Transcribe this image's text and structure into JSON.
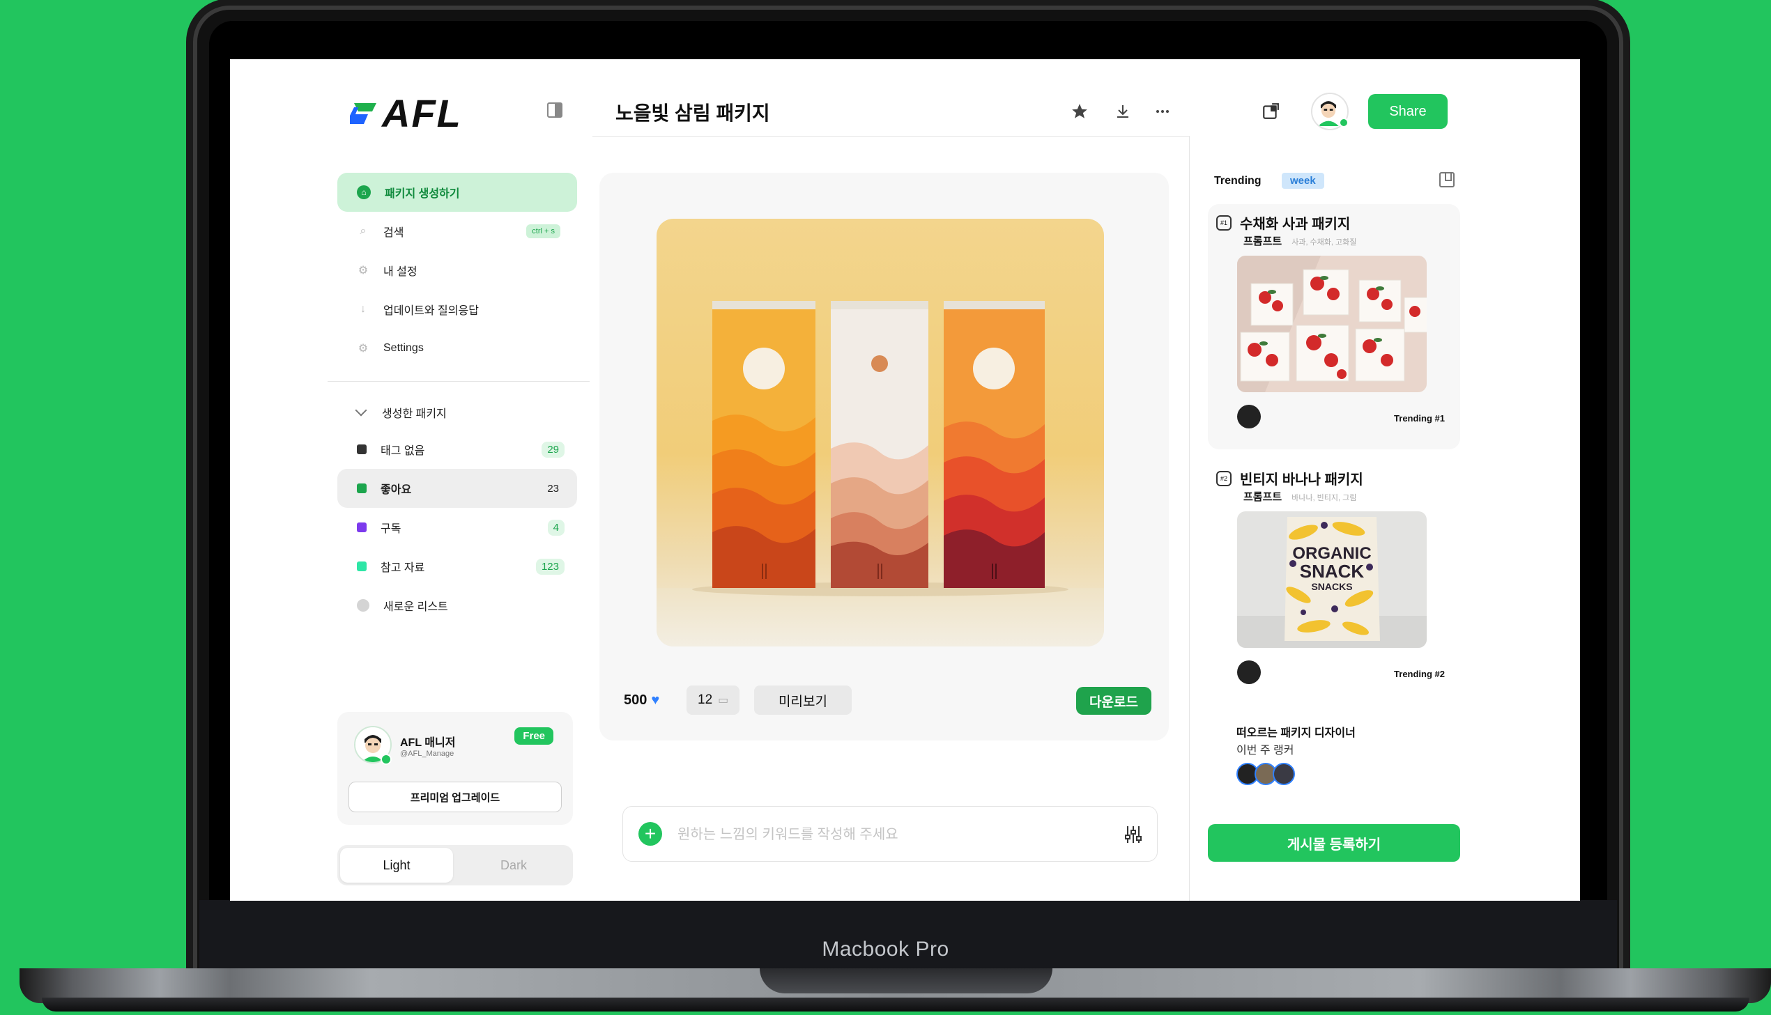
{
  "device": {
    "label": "Macbook Pro"
  },
  "brand": {
    "name": "AFL",
    "accent": "#22c55e"
  },
  "sidebar": {
    "nav": [
      {
        "label": "패키지 생성하기",
        "icon": "package-icon",
        "active": true
      },
      {
        "label": "검색",
        "icon": "search-icon",
        "shortcut": "ctrl + s"
      },
      {
        "label": "내 설정",
        "icon": "gear-icon"
      },
      {
        "label": "업데이트와 질의응답",
        "icon": "arrow-down-icon"
      },
      {
        "label": "Settings",
        "icon": "gear-icon"
      }
    ],
    "lists_header": "생성한 패키지",
    "lists": [
      {
        "label": "태그 없음",
        "count": "29",
        "color": "#333333"
      },
      {
        "label": "좋아요",
        "count": "23",
        "color": "#1ca54d",
        "active": true
      },
      {
        "label": "구독",
        "count": "4",
        "color": "#7c3aed"
      },
      {
        "label": "참고 자료",
        "count": "123",
        "color": "#2ee6a6"
      },
      {
        "label": "새로운 리스트",
        "count": "",
        "color": "#d4d4d4"
      }
    ],
    "profile": {
      "name": "AFL 매니저",
      "handle": "@AFL_Manage",
      "plan": "Free",
      "upgrade_label": "프리미엄 업그레이드"
    },
    "theme": {
      "light": "Light",
      "dark": "Dark",
      "selected": "Light"
    }
  },
  "header": {
    "title": "노을빛 삼림 패키지",
    "share_label": "Share",
    "icons": [
      "star-icon",
      "download-icon",
      "more-icon",
      "new-window-icon"
    ]
  },
  "main": {
    "likes": "500",
    "comments": "12",
    "preview_label": "미리보기",
    "download_label": "다운로드",
    "prompt_placeholder": "원하는 느낌의 키워드를 작성해 주세요"
  },
  "trending": {
    "label": "Trending",
    "period": "week",
    "items": [
      {
        "rank_badge": "#1",
        "title": "수채화 사과 패키지",
        "prompt_label": "프롬프트",
        "tags": "사과, 수채화, 고화질",
        "rank_label": "Trending #1"
      },
      {
        "rank_badge": "#2",
        "title": "빈티지 바나나 패키지",
        "prompt_label": "프롬프트",
        "tags": "바나나, 빈티지, 그림",
        "rank_label": "Trending #2"
      }
    ],
    "rising_title": "떠오르는 패키지 디자이너",
    "rising_sub": "이번 주 랭커",
    "post_label": "게시물 등록하기"
  },
  "product_image_text": {
    "snack_line1": "ORGANIC",
    "snack_line2": "SNACK",
    "snack_line3": "SNACKS"
  }
}
